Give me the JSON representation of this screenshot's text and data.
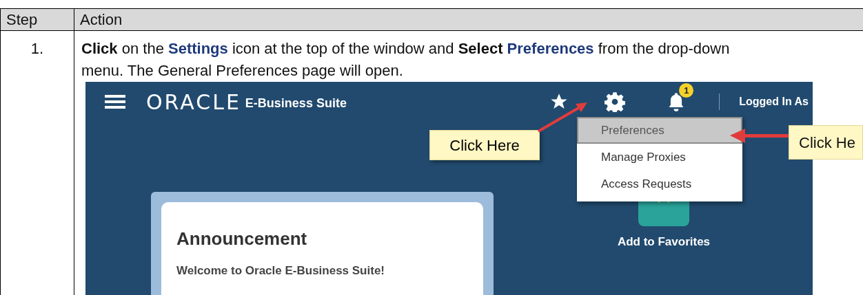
{
  "table": {
    "columns": [
      "Step",
      "Action"
    ],
    "rows": [
      {
        "step": "1.",
        "instruction": [
          {
            "kind": "bold",
            "text": "Click"
          },
          {
            "kind": "plain",
            "text": " on the "
          },
          {
            "kind": "term",
            "text": "Settings"
          },
          {
            "kind": "plain",
            "text": " icon at the top of the window and "
          },
          {
            "kind": "bold",
            "text": "Select "
          },
          {
            "kind": "term",
            "text": "Preferences"
          },
          {
            "kind": "plain",
            "text": " from the drop-down menu.  The General Preferences page will open."
          }
        ],
        "screenshot": {
          "logo": "ORACLE",
          "product": "E-Business Suite",
          "notification_count": "1",
          "user_label": "Logged In As",
          "menu": [
            {
              "label": "Preferences",
              "selected": true
            },
            {
              "label": "Manage Proxies",
              "selected": false
            },
            {
              "label": "Access Requests",
              "selected": false
            }
          ],
          "announcement": {
            "title": "Announcement",
            "text": "Welcome to Oracle E-Business Suite!"
          },
          "favorites": "Add to Favorites",
          "callouts": [
            "Click Here",
            "Click He"
          ]
        }
      }
    ]
  }
}
